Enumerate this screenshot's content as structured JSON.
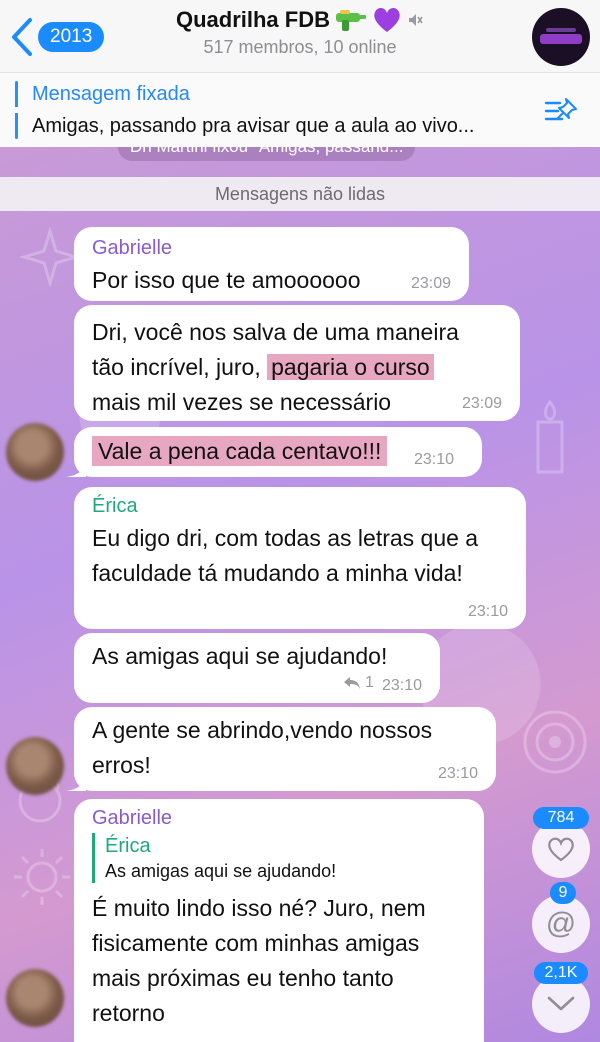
{
  "header": {
    "back_badge": "2013",
    "title": "Quadrilha FDB",
    "subtitle": "517 membros, 10 online"
  },
  "pinned": {
    "title": "Mensagem fixada",
    "text": "Amigas, passando pra avisar que a aula ao vivo..."
  },
  "system_message": "Dri Martini fixou \"Amigas, passand...",
  "unread_label": "Mensagens não lidas",
  "messages": [
    {
      "sender": "Gabrielle",
      "text": "Por isso que te amoooooo",
      "time": "23:09"
    },
    {
      "text_a": "Dri, você nos salva de uma maneira",
      "text_b": "tão incrível, juro, ",
      "highlight": "pagaria o curso",
      "text_c": "mais mil vezes se necessário",
      "time": "23:09"
    },
    {
      "highlight": "Vale a pena cada centavo!!!",
      "time": "23:10"
    },
    {
      "sender": "Érica",
      "text": "Eu digo dri, com todas as letras que a faculdade tá mudando a minha vida!",
      "time": "23:10"
    },
    {
      "text": "As amigas aqui se ajudando!",
      "replies": "1",
      "time": "23:10"
    },
    {
      "text": "A gente se abrindo,vendo nossos erros!",
      "time": "23:10"
    },
    {
      "sender": "Gabrielle",
      "reply_name": "Érica",
      "reply_text": "As amigas aqui se ajudando!",
      "text": "É muito lindo isso né? Juro, nem fisicamente com minhas amigas mais próximas eu tenho tanto retorno"
    }
  ],
  "fabs": {
    "reactions_count": "784",
    "mentions_count": "9",
    "scroll_count": "2,1K"
  },
  "colors": {
    "accent": "#1a8cff",
    "gabrielle": "#8a5cc8",
    "erica": "#1fa87c",
    "highlight": "#e8a7c0"
  }
}
